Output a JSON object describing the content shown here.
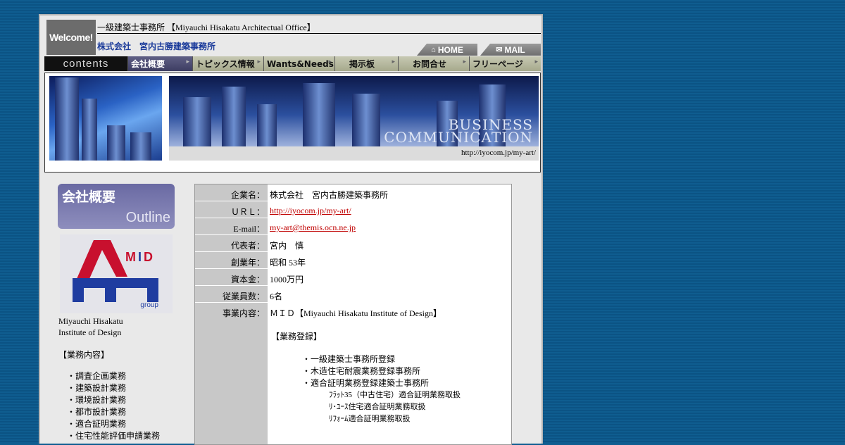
{
  "header": {
    "welcome": "Welcome!",
    "office_title": "一級建築士事務所 【Miyauchi Hisakatu Architectual Office】",
    "company_name": "株式会社　宮内古勝建築事務所",
    "home_label": "HOME",
    "mail_label": "MAIL"
  },
  "nav": {
    "contents_label": "contents",
    "items": [
      {
        "label": "会社概要"
      },
      {
        "label": "トピックス情報"
      },
      {
        "label": "Wants&Needs"
      },
      {
        "label": "掲示板"
      },
      {
        "label": "お問合せ"
      },
      {
        "label": "フリーページ"
      }
    ]
  },
  "banner": {
    "business_line1": "BUSINESS",
    "business_line2": "COMMUNICATION",
    "url": "http://iyocom.jp/my-art/"
  },
  "sidebar": {
    "outline_jp": "会社概要",
    "outline_en": "Outline",
    "logo_text": "MID",
    "logo_group": "group",
    "name_line1": "Miyauchi Hisakatu",
    "name_line2": "Institute of Design",
    "business_heading": "【業務内容】",
    "business_items": [
      "・調査企画業務",
      "・建築設計業務",
      "・環境設計業務",
      "・都市設計業務",
      "・適合証明業務",
      "・住宅性能評価申請業務"
    ]
  },
  "info": {
    "rows": [
      {
        "label": "企業名：",
        "value": "株式会社　宮内古勝建築事務所"
      },
      {
        "label": "ＵＲＬ：",
        "value": "http://iyocom.jp/my-art/"
      },
      {
        "label": "E-mail：",
        "value": "my-art@themis.ocn.ne.jp"
      },
      {
        "label": "代表者：",
        "value": "宮内　慎"
      },
      {
        "label": "創業年：",
        "value": "昭和 53年"
      },
      {
        "label": "資本金：",
        "value": "1000万円"
      },
      {
        "label": "従業員数：",
        "value": "6名"
      },
      {
        "label": "事業内容：",
        "value": "ＭＩＤ【Miyauchi Hisakatu Institute of Design】"
      }
    ],
    "registration_heading": "【業務登録】",
    "registration_items": [
      "・一級建築士事務所登録",
      "・木造住宅耐震業務登録事務所",
      "・適合証明業務登録建築士事務所"
    ],
    "registration_subitems": [
      "ﾌﾗｯﾄ35（中古住宅）適合証明業務取扱",
      "ﾘ･ﾕｰｽ住宅適合証明業務取扱",
      "ﾘﾌｫｰﾑ適合証明業務取扱"
    ]
  }
}
